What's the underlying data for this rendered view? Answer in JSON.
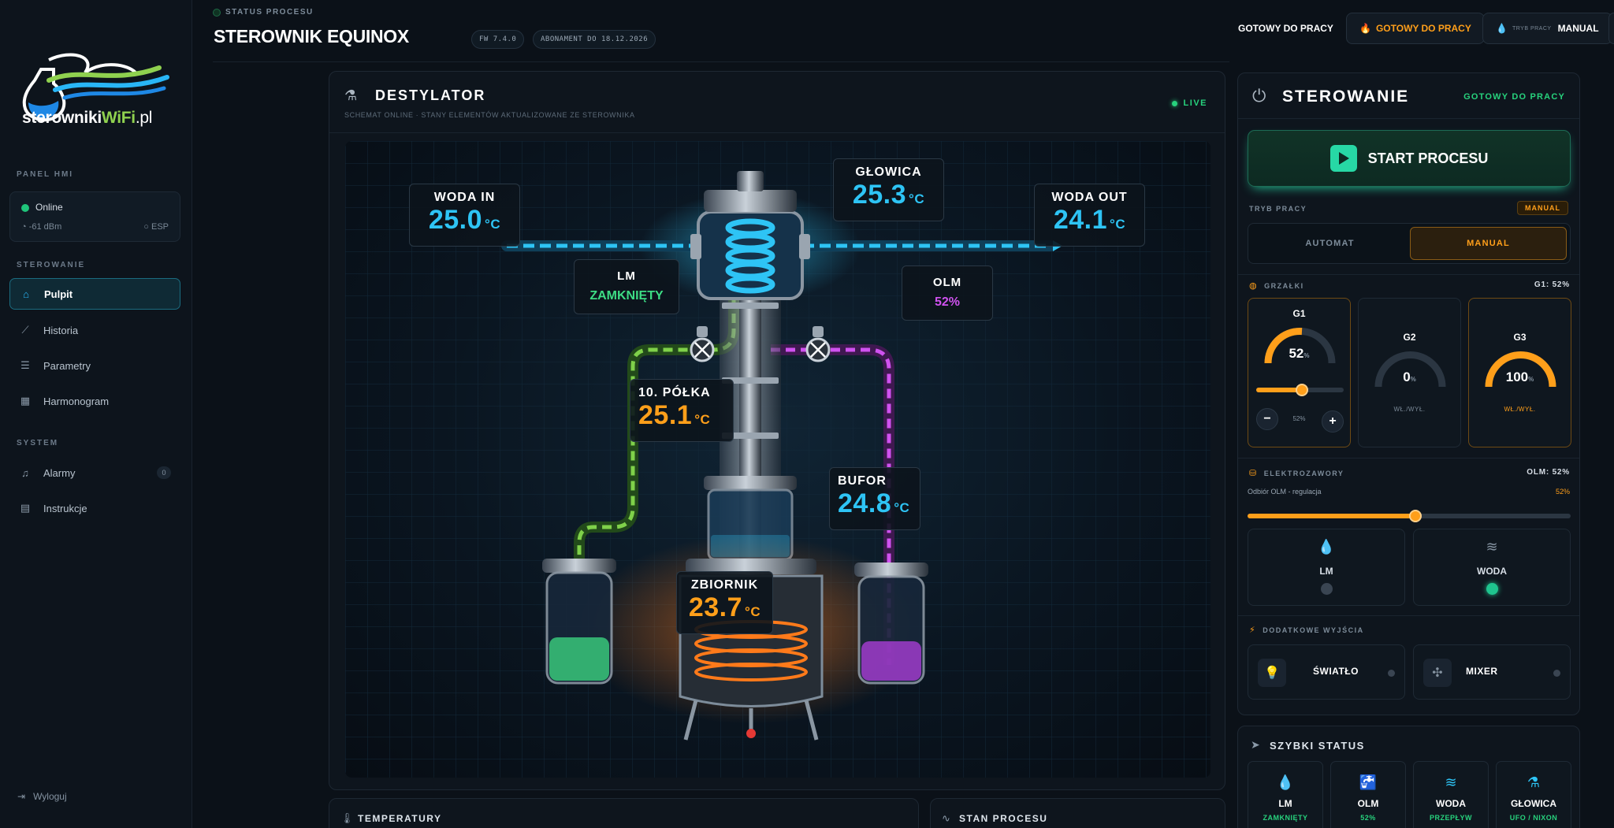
{
  "brand": {
    "logo_text_main": "sterowniki",
    "logo_text_accent": "WiFi",
    "logo_text_suffix": ".pl"
  },
  "sidebar": {
    "section_panel": "PANEL HMI",
    "connection": {
      "status": "Online",
      "signal": "-61 dBm",
      "device": "ESP"
    },
    "section_control": "STEROWANIE",
    "nav": [
      {
        "label": "Pulpit",
        "icon": "home-icon",
        "active": true
      },
      {
        "label": "Historia",
        "icon": "chart-line-icon"
      },
      {
        "label": "Parametry",
        "icon": "sliders-icon"
      },
      {
        "label": "Harmonogram",
        "icon": "calendar-icon"
      }
    ],
    "section_system": "SYSTEM",
    "system_nav": [
      {
        "label": "Alarmy",
        "icon": "bell-icon",
        "badge": "0"
      },
      {
        "label": "Instrukcje",
        "icon": "book-icon"
      }
    ],
    "logout": "Wyloguj"
  },
  "header": {
    "status_label": "STATUS PROCESU",
    "title": "STEROWNIK EQUINOX",
    "fw_chip": "FW 7.4.0",
    "subscription_chip": "ABONAMENT DO 18.12.2026",
    "ready_text": "GOTOWY DO PRACY",
    "ready_pill": "GOTOWY DO PRACY",
    "mode_pill_label": "TRYB PRACY",
    "mode_pill_value": "MANUAL"
  },
  "diagram": {
    "title": "DESTYLATOR",
    "subtitle": "SCHEMAT ONLINE · STANY ELEMENTÓW AKTUALIZOWANE ZE STEROWNIKA",
    "live": "LIVE",
    "tags": {
      "water_in": {
        "label": "WODA IN",
        "value": "25.0",
        "unit": "°C"
      },
      "head": {
        "label": "GŁOWICA",
        "value": "25.3",
        "unit": "°C"
      },
      "water_out": {
        "label": "WODA OUT",
        "value": "24.1",
        "unit": "°C"
      },
      "lm": {
        "label": "LM",
        "value": "ZAMKNIĘTY"
      },
      "olm": {
        "label": "OLM",
        "value": "52%"
      },
      "shelf": {
        "label": "10. PÓŁKA",
        "value": "25.1",
        "unit": "°C"
      },
      "buffer": {
        "label": "BUFOR",
        "value": "24.8",
        "unit": "°C"
      },
      "tank": {
        "label": "ZBIORNIK",
        "value": "23.7",
        "unit": "°C"
      }
    },
    "colors": {
      "water": "#2ec4f5",
      "lm_line": "#7fd14a",
      "olm_line": "#d052f0",
      "heat": "#ff7a1a"
    }
  },
  "bottom_panels": {
    "temperatures": "TEMPERATURY",
    "process_state": "STAN PROCESU"
  },
  "control": {
    "title": "STEROWANIE",
    "ready": "GOTOWY DO PRACY",
    "start_button": "START PROCESU",
    "mode_label": "TRYB PRACY",
    "mode_badge": "MANUAL",
    "mode_options": [
      "AUTOMAT",
      "MANUAL"
    ],
    "heaters_label": "GRZAŁKI",
    "heaters_summary": "G1: 52%",
    "heaters": [
      {
        "name": "G1",
        "percent": 52,
        "value_text": "52",
        "unit": "%",
        "slider_text": "52%",
        "minus": "−",
        "plus": "+"
      },
      {
        "name": "G2",
        "percent": 0,
        "value_text": "0",
        "unit": "%",
        "mode": "WŁ./WYŁ."
      },
      {
        "name": "G3",
        "percent": 100,
        "value_text": "100",
        "unit": "%",
        "mode": "WŁ./WYŁ."
      }
    ],
    "valves_label": "ELEKTROZAWORY",
    "valves_summary": "OLM: 52%",
    "olm_slider_label": "Odbiór OLM - regulacja",
    "olm_slider_value_text": "52%",
    "olm_slider_percent": 52,
    "valves": [
      {
        "name": "LM",
        "icon": "drop-icon",
        "on": false
      },
      {
        "name": "WODA",
        "icon": "waves-icon",
        "on": true
      }
    ],
    "outputs_label": "DODATKOWE WYJŚCIA",
    "outputs": [
      {
        "name": "ŚWIATŁO",
        "icon": "bulb-icon"
      },
      {
        "name": "MIXER",
        "icon": "fan-icon"
      }
    ]
  },
  "quick_status": {
    "title": "SZYBKI STATUS",
    "items": [
      {
        "name": "LM",
        "status": "ZAMKNIĘTY",
        "icon": "drop-icon"
      },
      {
        "name": "OLM",
        "status": "52%",
        "icon": "faucet-icon"
      },
      {
        "name": "WODA",
        "status": "PRZEPŁYW",
        "icon": "waves-icon"
      },
      {
        "name": "GŁOWICA",
        "status": "UFO / NIXON",
        "icon": "flask-icon"
      }
    ]
  }
}
